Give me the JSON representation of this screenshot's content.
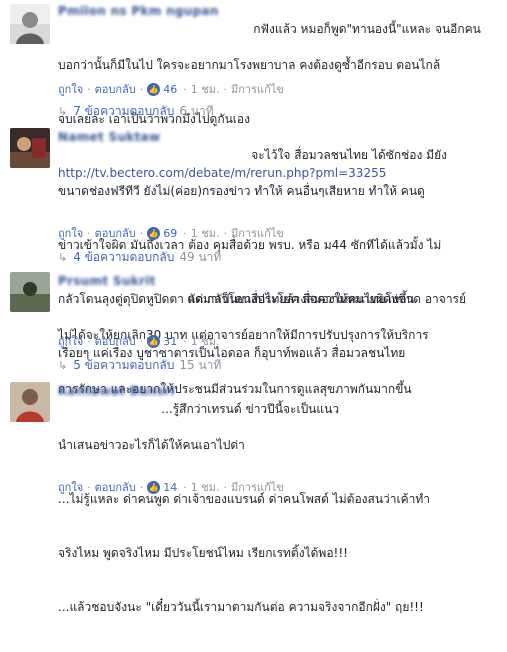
{
  "comments": [
    {
      "author": "Pmilon ns Pkm ngupan",
      "lines": [
        "กฟังแล้ว หมอก็พูด\"ทานองนี้\"แหละ จนอีกคน",
        "บอกว่านั้นก็มีในไป ใครจะอยากมาโรงพยาบาล คงต้องดูซ้ำอีกรอบ ตอนไกล้",
        "จบเลยละ เอาเป็นว่าพวกมึงไปดูกันเอง"
      ],
      "link": "http://tv.bectero.com/debate/m/rerun.php?pml=33255",
      "actions": {
        "like": "ถูกใจ",
        "reply": "ตอบกลับ",
        "reactions": "46",
        "time": "1 ชม.",
        "edited": "มีการแก้ไข"
      },
      "replies": {
        "label": "7 ข้อความตอบกลับ",
        "time": "6 นาที"
      }
    },
    {
      "author": "Namet Suktaw",
      "first_line_rest": "จะไว้ใจ สื่อมวลชนไทย ได้ซักช่อง มียัง",
      "lines": [
        "ขนาดช่องฟรีทีวี ยังไม่(ค่อย)กรองข่าว ทำให้ คนอื่นๆเสียหาย ทำให้ คนดู",
        "ข่าวเข้าใจผิด มันถึงเวลา ต้อง คุมสื่อด้วย พรบ. หรือ ม44 ซักทีได้แล้วมั้ง ไม่",
        "กลัวโดนลุงตู่ดุปิดหูปิดตา แต่ กลัวโดนสื่อไทยล้างสมองให้คนไทยโง่ขึ้น",
        "เรื่อยๆ แค่เรื่อง บูชาซาตารเป็นไอดอล ก็อุบาท์พอแล้ว สื่อมวลชนไทย"
      ],
      "actions": {
        "like": "ถูกใจ",
        "reply": "ตอบกลับ",
        "reactions": "69",
        "time": "1 ชม.",
        "edited": "มีการแก้ไข"
      },
      "replies": {
        "label": "4 ข้อความตอบกลับ",
        "time": "49 นาที"
      }
    },
    {
      "author": "Prsumt Sukrit",
      "first_line_rest": "ตัดมาเป็นยางประโยค สื่อความหมายผิดพลาด อาจารย์",
      "lines": [
        "ไม่ได้จะให้ยกเลิก30 บาท แต่อาจารย์อยากให้มีการปรับปรุงการให้บริการ",
        "การรักษา และอยากให้ประชนมีส่วนร่วมในการดูแลสุขภาพกันมากขึ้น"
      ],
      "actions": {
        "like": "ถูกใจ",
        "reply": "ตอบกลับ",
        "reactions": "31",
        "time": "1 ชม.",
        "edited": ""
      },
      "replies": {
        "label": "5 ข้อความตอบกลับ",
        "time": "15 นาที"
      }
    },
    {
      "author": "Kantawat Bunsri",
      "first_line_rest": "...รู้สึกว่าเทรนด์ ข่าวปีนี้จะเป็นแนว",
      "lines": [
        "นำเสนอข่าวอะไรก็ได้ให้คนเอาไปด่า",
        "...ไม่รู้แหละ ด่าคนพูด ด่าเจ้าของแบรนด์ ด่าคนโพสต์ ไม่ต้องสนว่าเค้าทำ",
        "จริงไหม พูดจริงไหม มีประโยชน์ไหม เรียกเรทติ้งได้พอ!!!",
        "...แล้วชอบจังนะ \"เดี๋ยววันนี้เรามาตามกันต่อ ความจริงจากอีกฝั่ง\" ฤย!!!"
      ],
      "actions": {
        "like": "ถูกใจ",
        "reply": "ตอบกลับ",
        "reactions": "14",
        "time": "1 ชม.",
        "edited": "มีการแก้ไข"
      }
    }
  ]
}
